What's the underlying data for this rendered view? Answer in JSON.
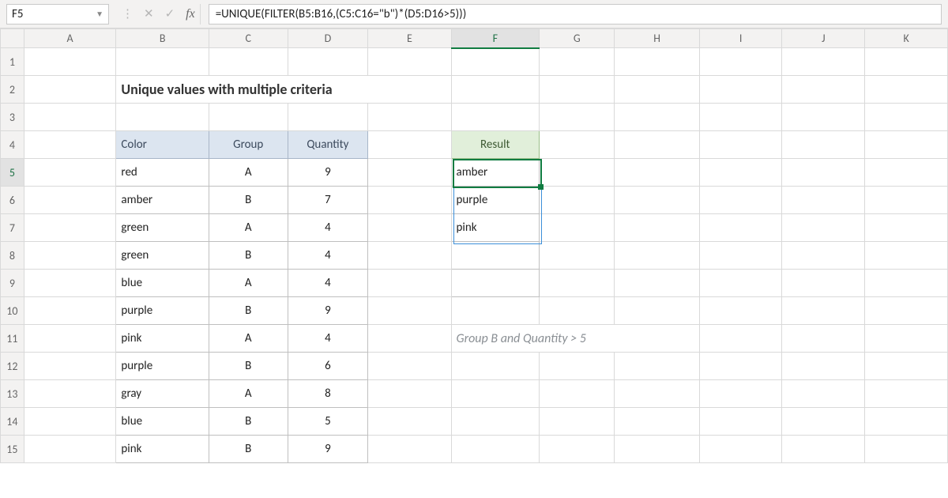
{
  "formula_bar": {
    "cell_ref": "F5",
    "formula": "=UNIQUE(FILTER(B5:B16,(C5:C16=\"b\")*(D5:D16>5)))"
  },
  "columns": [
    "A",
    "B",
    "C",
    "D",
    "E",
    "F",
    "G",
    "H",
    "I",
    "J",
    "K"
  ],
  "row_labels": [
    "1",
    "2",
    "3",
    "4",
    "5",
    "6",
    "7",
    "8",
    "9",
    "10",
    "11",
    "12",
    "13",
    "14",
    "15"
  ],
  "title": "Unique values with multiple criteria",
  "data_table": {
    "headers": {
      "color": "Color",
      "group": "Group",
      "quantity": "Quantity"
    },
    "rows": [
      {
        "color": "red",
        "group": "A",
        "quantity": "9"
      },
      {
        "color": "amber",
        "group": "B",
        "quantity": "7"
      },
      {
        "color": "green",
        "group": "A",
        "quantity": "4"
      },
      {
        "color": "green",
        "group": "B",
        "quantity": "4"
      },
      {
        "color": "blue",
        "group": "A",
        "quantity": "4"
      },
      {
        "color": "purple",
        "group": "B",
        "quantity": "9"
      },
      {
        "color": "pink",
        "group": "A",
        "quantity": "4"
      },
      {
        "color": "purple",
        "group": "B",
        "quantity": "6"
      },
      {
        "color": "gray",
        "group": "A",
        "quantity": "8"
      },
      {
        "color": "blue",
        "group": "B",
        "quantity": "5"
      },
      {
        "color": "pink",
        "group": "B",
        "quantity": "9"
      }
    ]
  },
  "result_table": {
    "header": "Result",
    "rows": [
      "amber",
      "purple",
      "pink",
      "",
      ""
    ]
  },
  "note": "Group B and Quantity > 5",
  "icons": {
    "dropdown": "▼",
    "dots": "⋮",
    "cancel": "✕",
    "enter": "✓",
    "fx": "fx"
  }
}
